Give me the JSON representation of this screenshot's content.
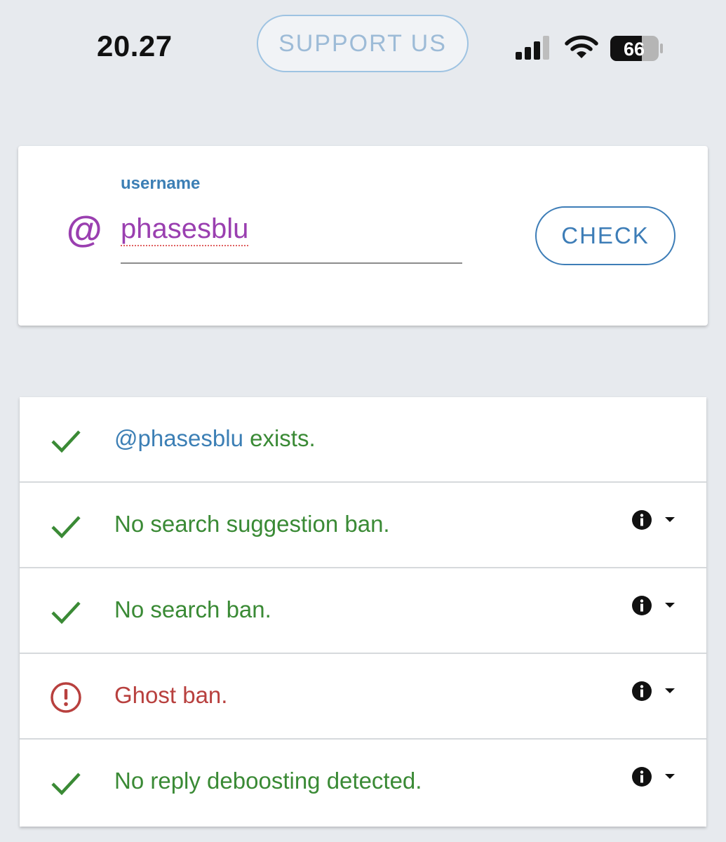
{
  "status_bar": {
    "time": "20.27",
    "support_label": "SUPPORT US",
    "battery_level": "66"
  },
  "search": {
    "field_label": "username",
    "at_symbol": "@",
    "username_value": "phasesblu",
    "check_label": "CHECK"
  },
  "results": [
    {
      "status": "ok",
      "handle": "@phasesblu",
      "text": " exists.",
      "has_info": false
    },
    {
      "status": "ok",
      "text": "No search suggestion ban.",
      "has_info": true
    },
    {
      "status": "ok",
      "text": "No search ban.",
      "has_info": true
    },
    {
      "status": "warning",
      "text": "Ghost ban.",
      "has_info": true
    },
    {
      "status": "ok",
      "text": "No reply deboosting detected.",
      "has_info": true
    }
  ],
  "colors": {
    "ok": "#3a8a35",
    "warning": "#b8403e",
    "accent": "#3d7db7",
    "username": "#9a3fb0"
  },
  "icons": {
    "ok": "check-icon",
    "warning": "alert-circle-icon",
    "info": "info-icon",
    "dropdown": "caret-down-icon"
  }
}
